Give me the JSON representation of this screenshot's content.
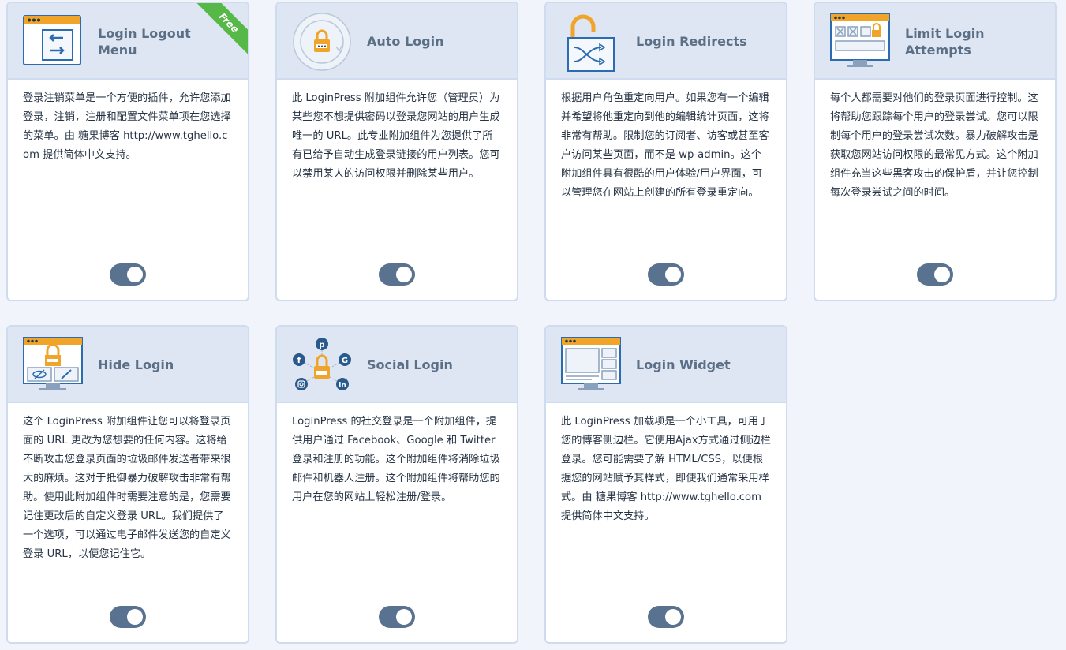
{
  "accent_colors": {
    "toggle": "#58728f",
    "header_bg": "#dde6f2",
    "border": "#cfdcef",
    "title": "#5b6f87",
    "ribbon": "#56b947",
    "icon_orange": "#f0a52a",
    "icon_blue": "#2b6cb0"
  },
  "cards": [
    {
      "title": "Login Logout\nMenu",
      "icon": "logout-menu-icon",
      "ribbon": "Free",
      "description": "登录注销菜单是一个方便的插件，允许您添加登录，注销，注册和配置文件菜单项在您选择的菜单。由 糖果博客 http://www.tghello.com 提供简体中文支持。",
      "enabled": true
    },
    {
      "title": "Auto Login",
      "icon": "auto-login-icon",
      "description": "此 LoginPress 附加组件允许您（管理员）为某些您不想提供密码以登录您网站的用户生成唯一的 URL。此专业附加组件为您提供了所有已给予自动生成登录链接的用户列表。您可以禁用某人的访问权限并删除某些用户。",
      "enabled": true
    },
    {
      "title": "Login Redirects",
      "icon": "login-redirects-icon",
      "description": "根据用户角色重定向用户。如果您有一个编辑并希望将他重定向到他的编辑统计页面，这将非常有帮助。限制您的订阅者、访客或甚至客户访问某些页面，而不是 wp-admin。这个附加组件具有很酷的用户体验/用户界面，可以管理您在网站上创建的所有登录重定向。",
      "enabled": true
    },
    {
      "title": "Limit Login\nAttempts",
      "icon": "limit-login-attempts-icon",
      "description": "每个人都需要对他们的登录页面进行控制。这将帮助您跟踪每个用户的登录尝试。您可以限制每个用户的登录尝试次数。暴力破解攻击是获取您网站访问权限的最常见方式。这个附加组件充当这些黑客攻击的保护盾，并让您控制每次登录尝试之间的时间。",
      "enabled": true
    },
    {
      "title": "Hide Login",
      "icon": "hide-login-icon",
      "description": "这个 LoginPress 附加组件让您可以将登录页面的 URL 更改为您想要的任何内容。这将给不断攻击您登录页面的垃圾邮件发送者带来很大的麻烦。这对于抵御暴力破解攻击非常有帮助。使用此附加组件时需要注意的是，您需要记住更改后的自定义登录 URL。我们提供了一个选项，可以通过电子邮件发送您的自定义登录 URL，以便您记住它。",
      "enabled": true
    },
    {
      "title": "Social Login",
      "icon": "social-login-icon",
      "description": "LoginPress 的社交登录是一个附加组件，提供用户通过 Facebook、Google 和 Twitter 登录和注册的功能。这个附加组件将消除垃圾邮件和机器人注册。这个附加组件将帮助您的用户在您的网站上轻松注册/登录。",
      "enabled": true
    },
    {
      "title": "Login Widget",
      "icon": "login-widget-icon",
      "description": "此 LoginPress 加载项是一个小工具，可用于您的博客侧边栏。它使用Ajax方式通过侧边栏登录。您可能需要了解 HTML/CSS，以便根据您的网站赋予其样式，即使我们通常采用样式。由 糖果博客 http://www.tghello.com 提供简体中文支持。",
      "enabled": true
    }
  ]
}
